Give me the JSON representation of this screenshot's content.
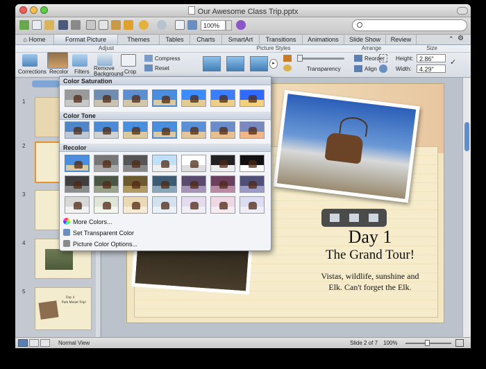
{
  "window": {
    "title": "Our Awesome Class Trip.pptx"
  },
  "toolbar": {
    "zoom": "100%"
  },
  "tabs": [
    {
      "label": "Home",
      "active": false
    },
    {
      "label": "Format Picture",
      "active": true
    },
    {
      "label": "Themes",
      "active": false
    },
    {
      "label": "Tables",
      "active": false
    },
    {
      "label": "Charts",
      "active": false
    },
    {
      "label": "SmartArt",
      "active": false
    },
    {
      "label": "Transitions",
      "active": false
    },
    {
      "label": "Animations",
      "active": false
    },
    {
      "label": "Slide Show",
      "active": false
    },
    {
      "label": "Review",
      "active": false
    }
  ],
  "ribbon": {
    "groups": {
      "adjust": "Adjust",
      "picture_styles": "Picture Styles",
      "arrange": "Arrange",
      "size": "Size"
    },
    "buttons": {
      "corrections": "Corrections",
      "recolor": "Recolor",
      "filters": "Filters",
      "remove_background": "Remove Background",
      "crop": "Crop",
      "compress": "Compress",
      "reset": "Reset",
      "transparency": "Transparency",
      "reorder": "Reorder",
      "align": "Align"
    },
    "size": {
      "height_label": "Height:",
      "height_value": "2.86\"",
      "width_label": "Width:",
      "width_value": "4.29\""
    }
  },
  "recolor_menu": {
    "sections": {
      "saturation": "Color Saturation",
      "tone": "Color Tone",
      "recolor": "Recolor"
    },
    "items": {
      "more_colors": "More Colors...",
      "set_transparent": "Set Transparent Color",
      "options": "Picture Color Options..."
    }
  },
  "slide": {
    "title": "Day 1",
    "subtitle": "The Grand Tour!",
    "body_line1": "Vistas, wildlife, sunshine and",
    "body_line2": "Elk. Can't forget the Elk."
  },
  "thumbs": [
    {
      "num": "1"
    },
    {
      "num": "2"
    },
    {
      "num": "3"
    },
    {
      "num": "4"
    },
    {
      "num": "5"
    }
  ],
  "thumb5": {
    "line1": "Day 4",
    "line2": "Park Mount Trip!"
  },
  "status": {
    "view": "Normal View",
    "slide_of": "Slide 2 of 7",
    "zoom": "100%"
  }
}
